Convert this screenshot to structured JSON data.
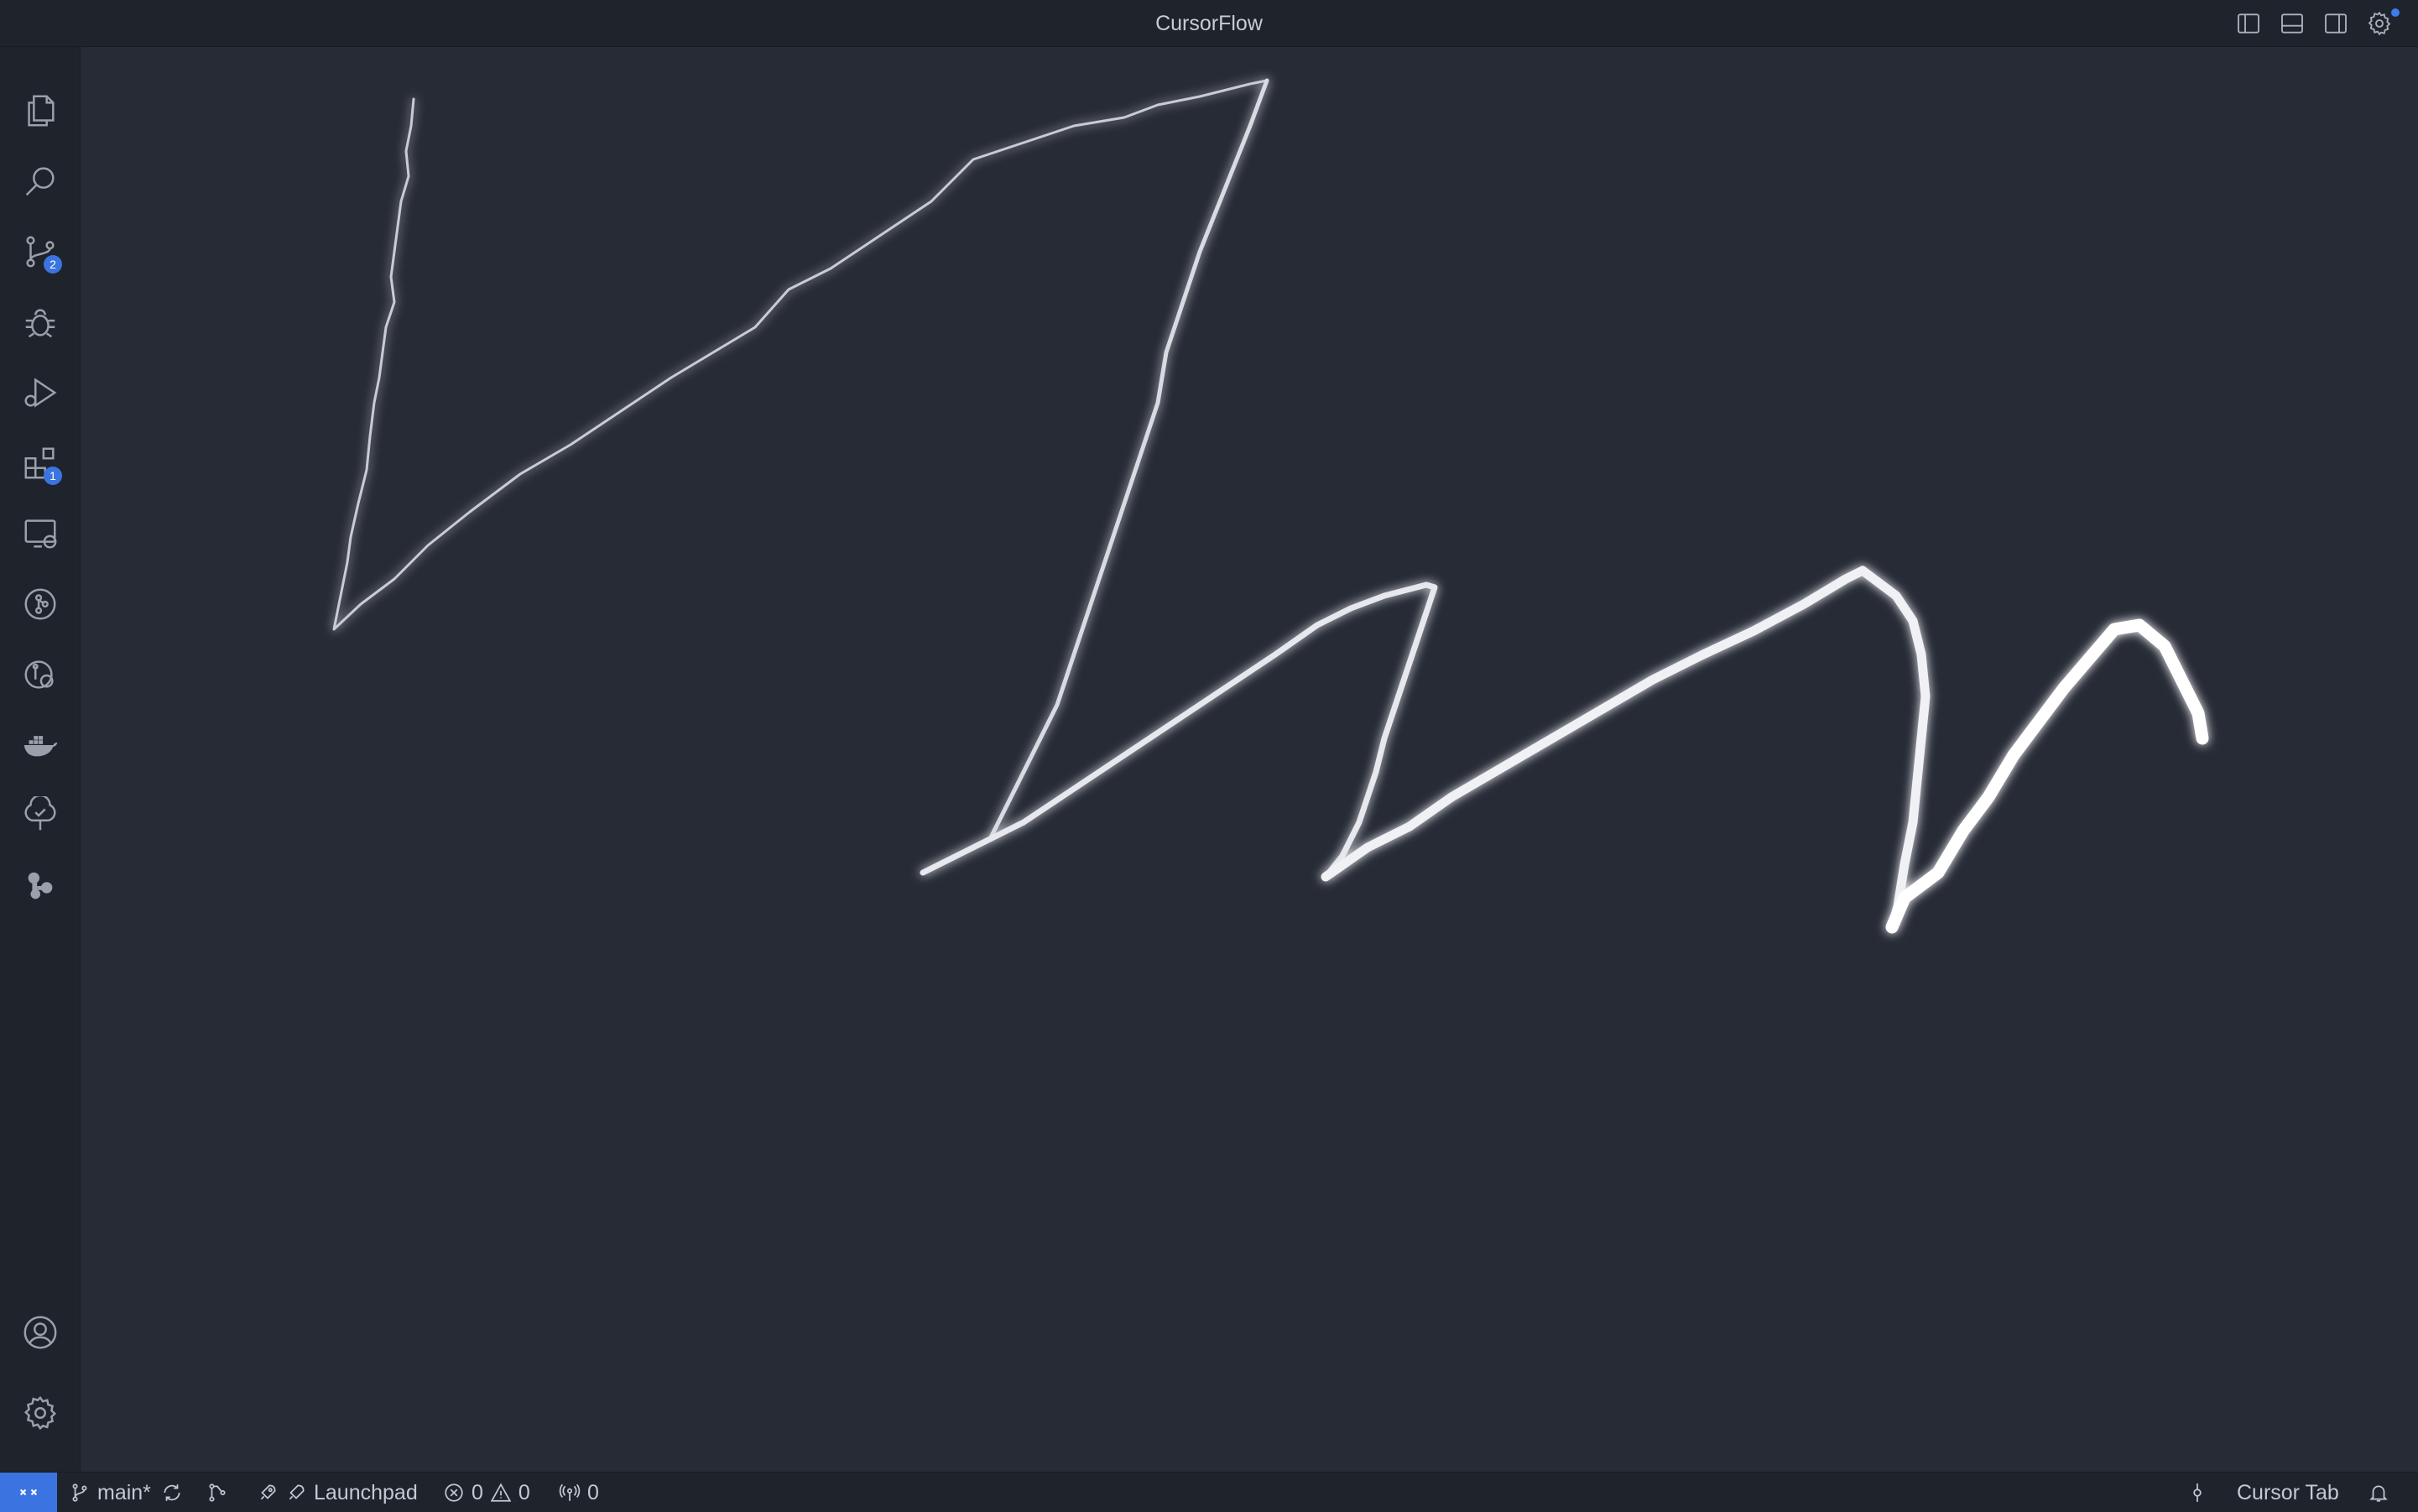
{
  "window": {
    "title": "CursorFlow"
  },
  "title_actions": [
    {
      "name": "toggle-primary-sidebar-icon"
    },
    {
      "name": "toggle-panel-icon"
    },
    {
      "name": "toggle-secondary-sidebar-icon"
    },
    {
      "name": "settings-gear-icon",
      "has_update_dot": true
    }
  ],
  "activity_bar": {
    "items": [
      {
        "id": "explorer",
        "icon": "files-icon"
      },
      {
        "id": "search",
        "icon": "search-icon"
      },
      {
        "id": "source-control",
        "icon": "source-control-icon",
        "badge": "2"
      },
      {
        "id": "debug",
        "icon": "bug-icon"
      },
      {
        "id": "run-and-debug",
        "icon": "run-debug-icon"
      },
      {
        "id": "extensions",
        "icon": "extensions-icon",
        "badge": "1"
      },
      {
        "id": "remote-explorer",
        "icon": "remote-explorer-icon"
      },
      {
        "id": "git-graph",
        "icon": "git-graph-icon"
      },
      {
        "id": "timeline",
        "icon": "git-history-icon"
      },
      {
        "id": "docker",
        "icon": "docker-icon"
      },
      {
        "id": "testing",
        "icon": "tree-check-icon"
      },
      {
        "id": "plugins",
        "icon": "puzzle-gear-icon"
      }
    ],
    "bottom": [
      {
        "id": "accounts",
        "icon": "account-icon"
      },
      {
        "id": "manage",
        "icon": "gear-icon"
      }
    ]
  },
  "status_bar": {
    "remote_icon": "remote-indicator-icon",
    "branch": "main*",
    "sync_icon": "sync-icon",
    "graph_icon": "git-compare-icon",
    "launchpad": "Launchpad",
    "errors": "0",
    "warnings": "0",
    "ports": "0",
    "right": {
      "commit_icon": "git-commit-icon",
      "cursor_tab": "Cursor Tab",
      "bell_icon": "bell-icon"
    }
  },
  "colors": {
    "background": "#272b36",
    "chrome": "#1f232b",
    "accent": "#3b74e0",
    "stroke": "#ffffff"
  }
}
